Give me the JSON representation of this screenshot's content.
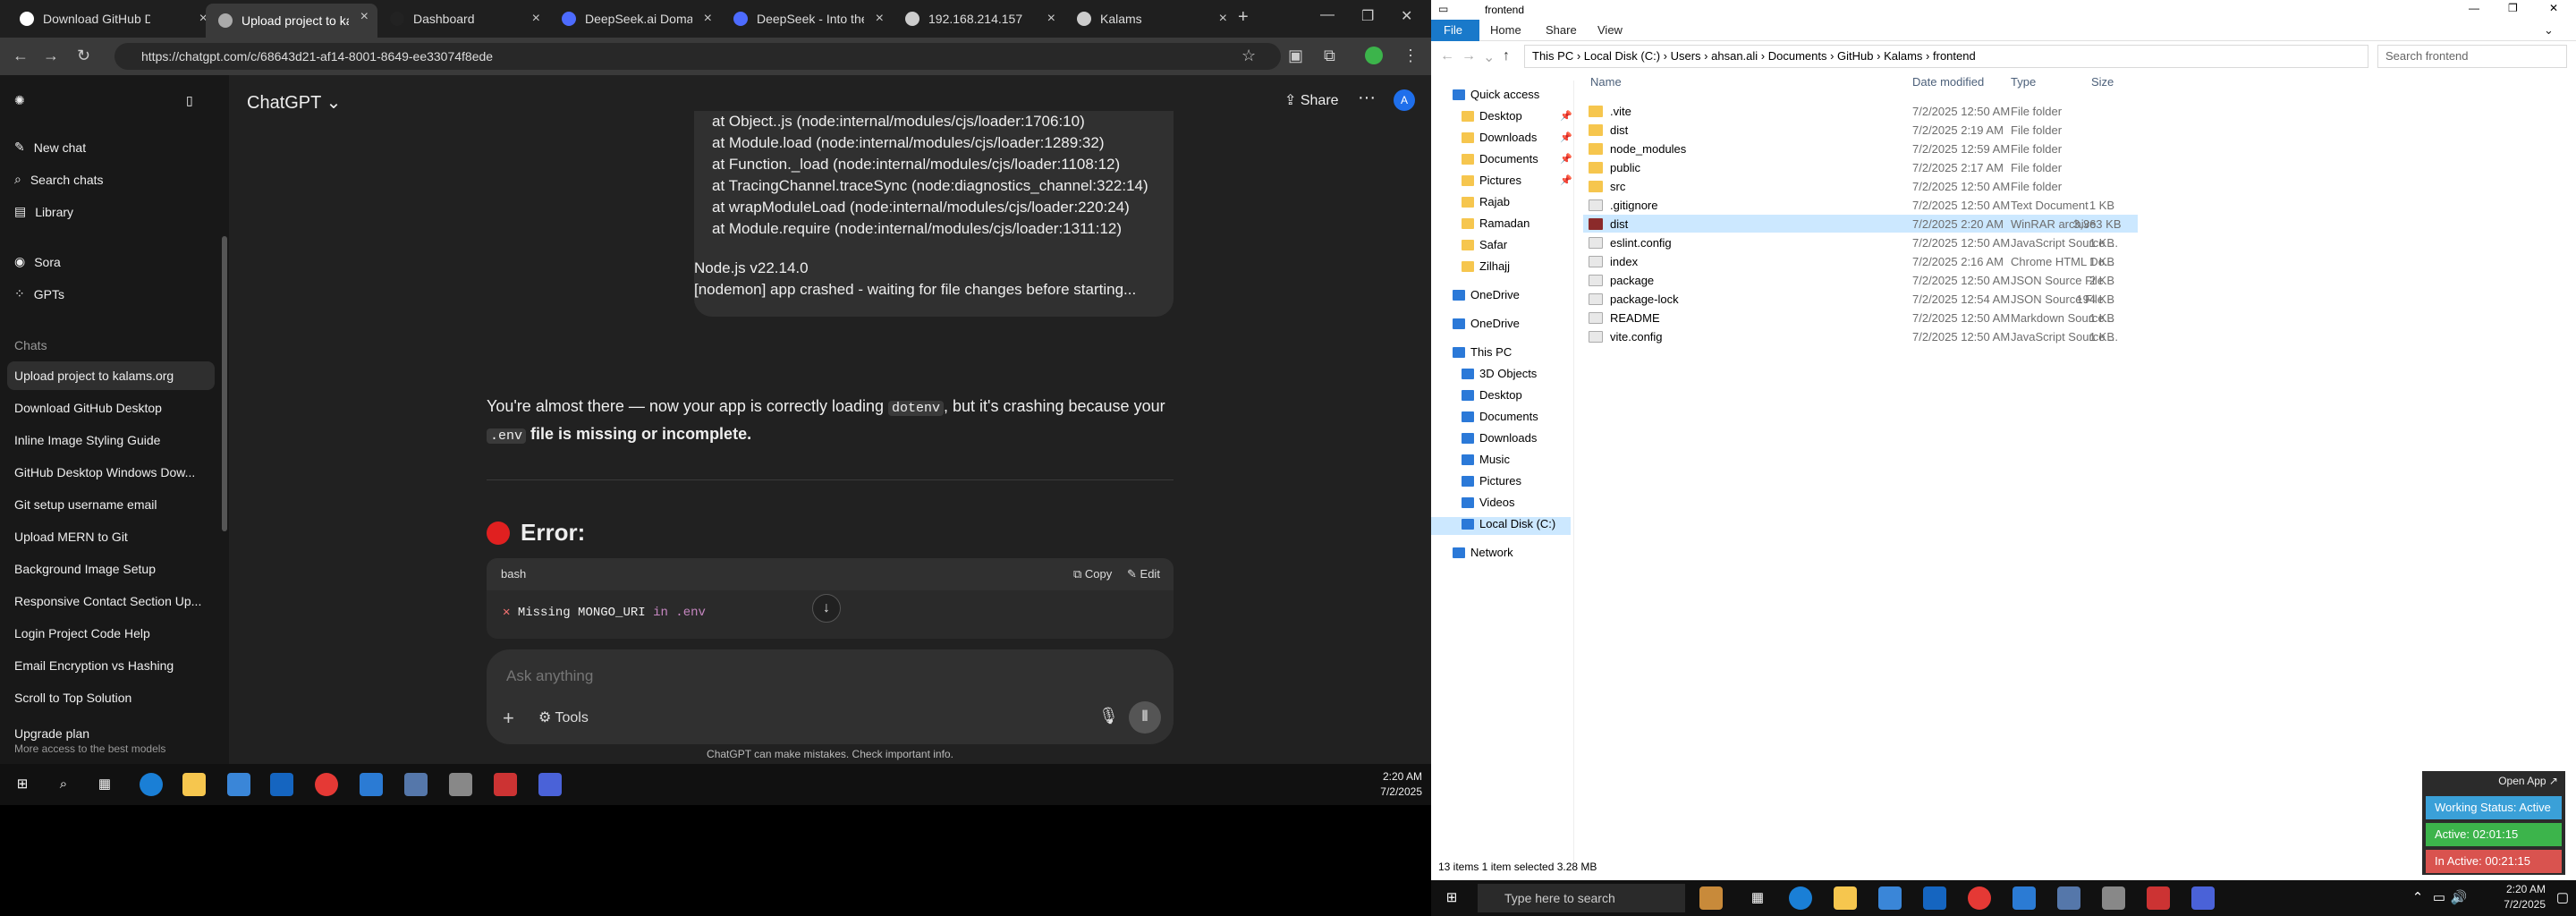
{
  "browser": {
    "tabs": [
      {
        "label": "Download GitHub Des",
        "active": false
      },
      {
        "label": "Upload project to kala",
        "active": true
      },
      {
        "label": "Dashboard",
        "active": false
      },
      {
        "label": "DeepSeek.ai Domain F",
        "active": false
      },
      {
        "label": "DeepSeek - Into the U",
        "active": false
      },
      {
        "label": "192.168.214.157",
        "active": false
      },
      {
        "label": "Kalams",
        "active": false
      }
    ],
    "url": "https://chatgpt.com/c/68643d21-af14-8001-8649-ee33074f8ede"
  },
  "sidebar": {
    "new_chat": "New chat",
    "search_chats": "Search chats",
    "library": "Library",
    "sora": "Sora",
    "gpts": "GPTs",
    "chats_heading": "Chats",
    "chats": [
      "Upload project to kalams.org",
      "Download GitHub Desktop",
      "Inline Image Styling Guide",
      "GitHub Desktop Windows Dow...",
      "Git setup username email",
      "Upload MERN to Git",
      "Background Image Setup",
      "Responsive Contact Section Up...",
      "Login Project Code Help",
      "Email Encryption vs Hashing",
      "Scroll to Top Solution"
    ],
    "upgrade_title": "Upgrade plan",
    "upgrade_sub": "More access to the best models"
  },
  "chat": {
    "title": "ChatGPT",
    "share": "Share",
    "avatar_letter": "A",
    "code_lines": [
      "at Object..js (node:internal/modules/cjs/loader:1706:10)",
      "at Module.load (node:internal/modules/cjs/loader:1289:32)",
      "at Function._load (node:internal/modules/cjs/loader:1108:12)",
      "at TracingChannel.traceSync (node:diagnostics_channel:322:14)",
      "at wrapModuleLoad (node:internal/modules/cjs/loader:220:24)",
      "at Module.require (node:internal/modules/cjs/loader:1311:12)",
      "Node.js v22.14.0",
      "[nodemon] app crashed - waiting for file changes before starting..."
    ],
    "answer_part1": "You're almost there — now your app is correctly loading ",
    "answer_kw1": "dotenv",
    "answer_part2": ", but it's crashing because your ",
    "answer_kw2": ".env",
    "answer_part3": " file is missing or incomplete.",
    "error_heading": "Error:",
    "bash_lang": "bash",
    "copy": "Copy",
    "edit": "Edit",
    "bash_x": "✕",
    "bash_text": " Missing MONGO_URI ",
    "bash_in": "in",
    "bash_env": " .env",
    "prompt_placeholder": "Ask anything",
    "tools": "Tools",
    "disclaimer": "ChatGPT can make mistakes. Check important info."
  },
  "taskbar_left": {
    "time": "2:20 AM",
    "date": "7/2/2025"
  },
  "explorer": {
    "window_title": "frontend",
    "ribbon_tabs": [
      "File",
      "Home",
      "Share",
      "View"
    ],
    "path": [
      "This PC",
      "Local Disk (C:)",
      "Users",
      "ahsan.ali",
      "Documents",
      "GitHub",
      "Kalams",
      "frontend"
    ],
    "search_placeholder": "Search frontend",
    "nav": {
      "quick_access": "Quick access",
      "quick_items": [
        "Desktop",
        "Downloads",
        "Documents",
        "Pictures",
        "Rajab",
        "Ramadan",
        "Safar",
        "Zilhajj"
      ],
      "onedrive1": "OneDrive",
      "onedrive2": "OneDrive",
      "this_pc": "This PC",
      "pc_items": [
        "3D Objects",
        "Desktop",
        "Documents",
        "Downloads",
        "Music",
        "Pictures",
        "Videos",
        "Local Disk (C:)"
      ],
      "network": "Network"
    },
    "columns": {
      "name": "Name",
      "date": "Date modified",
      "type": "Type",
      "size": "Size"
    },
    "files": [
      {
        "name": ".vite",
        "date": "7/2/2025 12:50 AM",
        "type": "File folder",
        "size": "",
        "kind": "folder"
      },
      {
        "name": "dist",
        "date": "7/2/2025 2:19 AM",
        "type": "File folder",
        "size": "",
        "kind": "folder"
      },
      {
        "name": "node_modules",
        "date": "7/2/2025 12:59 AM",
        "type": "File folder",
        "size": "",
        "kind": "folder"
      },
      {
        "name": "public",
        "date": "7/2/2025 2:17 AM",
        "type": "File folder",
        "size": "",
        "kind": "folder"
      },
      {
        "name": "src",
        "date": "7/2/2025 12:50 AM",
        "type": "File folder",
        "size": "",
        "kind": "folder"
      },
      {
        "name": ".gitignore",
        "date": "7/2/2025 12:50 AM",
        "type": "Text Document",
        "size": "1 KB",
        "kind": "file"
      },
      {
        "name": "dist",
        "date": "7/2/2025 2:20 AM",
        "type": "WinRAR archive",
        "size": "3,363 KB",
        "kind": "rar"
      },
      {
        "name": "eslint.config",
        "date": "7/2/2025 12:50 AM",
        "type": "JavaScript Source ...",
        "size": "1 KB",
        "kind": "file"
      },
      {
        "name": "index",
        "date": "7/2/2025 2:16 AM",
        "type": "Chrome HTML Do...",
        "size": "1 KB",
        "kind": "file"
      },
      {
        "name": "package",
        "date": "7/2/2025 12:50 AM",
        "type": "JSON Source File",
        "size": "2 KB",
        "kind": "file"
      },
      {
        "name": "package-lock",
        "date": "7/2/2025 12:54 AM",
        "type": "JSON Source File",
        "size": "194 KB",
        "kind": "file"
      },
      {
        "name": "README",
        "date": "7/2/2025 12:50 AM",
        "type": "Markdown Source...",
        "size": "1 KB",
        "kind": "file"
      },
      {
        "name": "vite.config",
        "date": "7/2/2025 12:50 AM",
        "type": "JavaScript Source ...",
        "size": "1 KB",
        "kind": "file"
      }
    ],
    "selected_index": 6,
    "status": "13 items    1 item selected  3.28 MB"
  },
  "widget": {
    "open_app": "Open App ↗",
    "working": "Working Status: Active",
    "active": "Active: 02:01:15",
    "inactive": "In Active: 00:21:15"
  },
  "taskbar_right": {
    "search": "Type here to search",
    "time": "2:20 AM",
    "date": "7/2/2025"
  },
  "colors": {
    "accent": "#1979ca",
    "working": "#3aa0d8",
    "active": "#3cb44b",
    "inactive": "#d9534f"
  }
}
